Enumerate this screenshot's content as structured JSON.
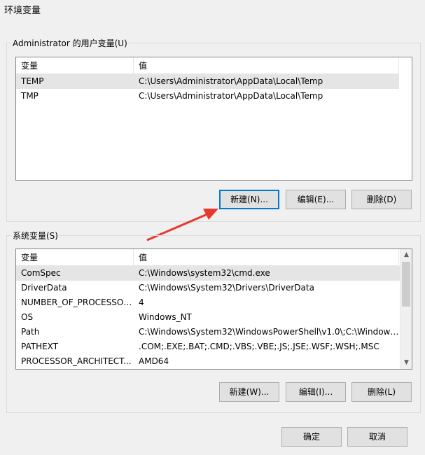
{
  "window": {
    "title": "环境变量"
  },
  "user_vars": {
    "group_label": "Administrator 的用户变量(U)",
    "headers": [
      "变量",
      "值"
    ],
    "rows": [
      [
        "TEMP",
        "C:\\Users\\Administrator\\AppData\\Local\\Temp"
      ],
      [
        "TMP",
        "C:\\Users\\Administrator\\AppData\\Local\\Temp"
      ]
    ],
    "buttons": {
      "new": "新建(N)...",
      "edit": "编辑(E)...",
      "delete": "删除(D)"
    }
  },
  "system_vars": {
    "group_label": "系统变量(S)",
    "headers": [
      "变量",
      "值"
    ],
    "rows": [
      [
        "ComSpec",
        "C:\\Windows\\system32\\cmd.exe"
      ],
      [
        "DriverData",
        "C:\\Windows\\System32\\Drivers\\DriverData"
      ],
      [
        "NUMBER_OF_PROCESSORS",
        "4"
      ],
      [
        "OS",
        "Windows_NT"
      ],
      [
        "Path",
        "C:\\Windows\\System32\\WindowsPowerShell\\v1.0\\;C:\\Windows..."
      ],
      [
        "PATHEXT",
        ".COM;.EXE;.BAT;.CMD;.VBS;.VBE;.JS;.JSE;.WSF;.WSH;.MSC"
      ],
      [
        "PROCESSOR_ARCHITECT...",
        "AMD64"
      ]
    ],
    "buttons": {
      "new": "新建(W)...",
      "edit": "编辑(I)...",
      "delete": "删除(L)"
    }
  },
  "dialog_buttons": {
    "ok": "确定",
    "cancel": "取消"
  },
  "colors": {
    "annotation_arrow": "#e8392e",
    "default_button_border": "#0078d7"
  }
}
